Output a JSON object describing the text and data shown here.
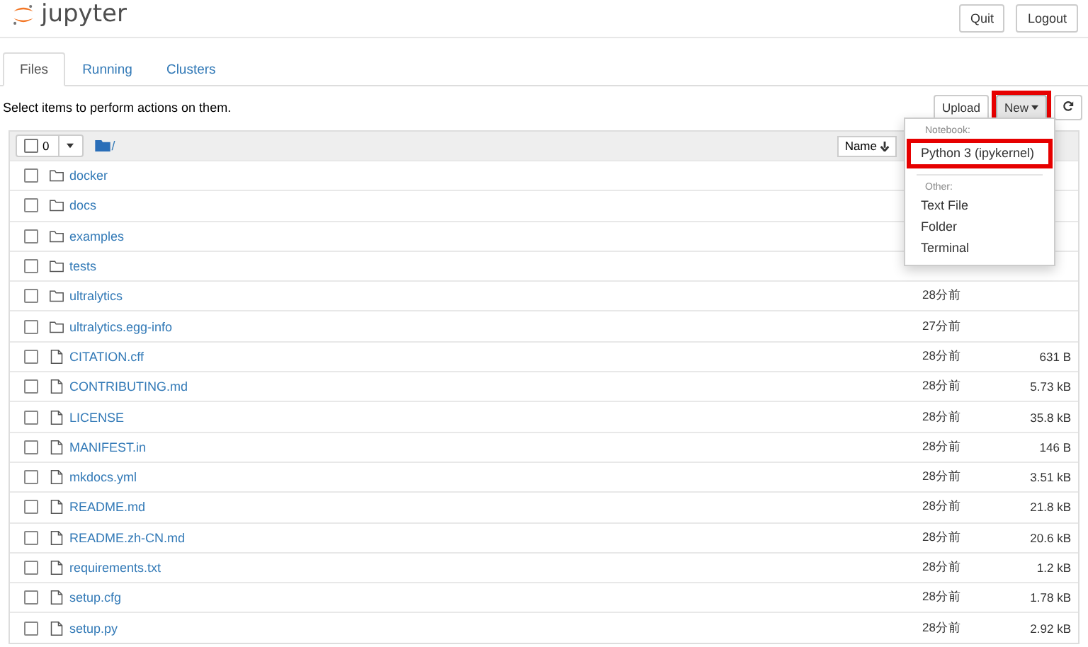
{
  "header": {
    "logo": "jupyter",
    "buttons": [
      "Quit",
      "Logout"
    ]
  },
  "tabs": [
    {
      "label": "Files",
      "selected": true
    },
    {
      "label": "Running",
      "selected": false
    },
    {
      "label": "Clusters",
      "selected": false
    }
  ],
  "hint": "Select items to perform actions on them.",
  "toolbar": {
    "upload": "Upload",
    "new": {
      "label": "New",
      "highlighted": true
    }
  },
  "list_header": {
    "count": "0",
    "path": "/",
    "sort": "Name",
    "all_checked": false
  },
  "new_menu": {
    "sections": [
      {
        "heading": "Notebook:",
        "items": [
          {
            "label": "Python 3 (ipykernel)",
            "highlighted": true
          }
        ]
      },
      {
        "heading": "Other:",
        "items": [
          {
            "label": "Text File",
            "highlighted": false
          },
          {
            "label": "Folder",
            "highlighted": false
          },
          {
            "label": "Terminal",
            "highlighted": false
          }
        ]
      }
    ]
  },
  "files": [
    {
      "kind": "folder",
      "name": "docker",
      "checked": false
    },
    {
      "kind": "folder",
      "name": "docs",
      "checked": false
    },
    {
      "kind": "folder",
      "name": "examples",
      "checked": false
    },
    {
      "kind": "folder",
      "name": "tests",
      "checked": false
    },
    {
      "kind": "folder",
      "name": "ultralytics",
      "modified": "28分前",
      "checked": false
    },
    {
      "kind": "folder",
      "name": "ultralytics.egg-info",
      "modified": "27分前",
      "checked": false
    },
    {
      "kind": "file",
      "name": "CITATION.cff",
      "modified": "28分前",
      "size": "631 B",
      "checked": false
    },
    {
      "kind": "file",
      "name": "CONTRIBUTING.md",
      "modified": "28分前",
      "size": "5.73 kB",
      "checked": false
    },
    {
      "kind": "file",
      "name": "LICENSE",
      "modified": "28分前",
      "size": "35.8 kB",
      "checked": false
    },
    {
      "kind": "file",
      "name": "MANIFEST.in",
      "modified": "28分前",
      "size": "146 B",
      "checked": false
    },
    {
      "kind": "file",
      "name": "mkdocs.yml",
      "modified": "28分前",
      "size": "3.51 kB",
      "checked": false
    },
    {
      "kind": "file",
      "name": "README.md",
      "modified": "28分前",
      "size": "21.8 kB",
      "checked": false
    },
    {
      "kind": "file",
      "name": "README.zh-CN.md",
      "modified": "28分前",
      "size": "20.6 kB",
      "checked": false
    },
    {
      "kind": "file",
      "name": "requirements.txt",
      "modified": "28分前",
      "size": "1.2 kB",
      "checked": false
    },
    {
      "kind": "file",
      "name": "setup.cfg",
      "modified": "28分前",
      "size": "1.78 kB",
      "checked": false
    },
    {
      "kind": "file",
      "name": "setup.py",
      "modified": "28分前",
      "size": "2.92 kB",
      "checked": false
    }
  ]
}
